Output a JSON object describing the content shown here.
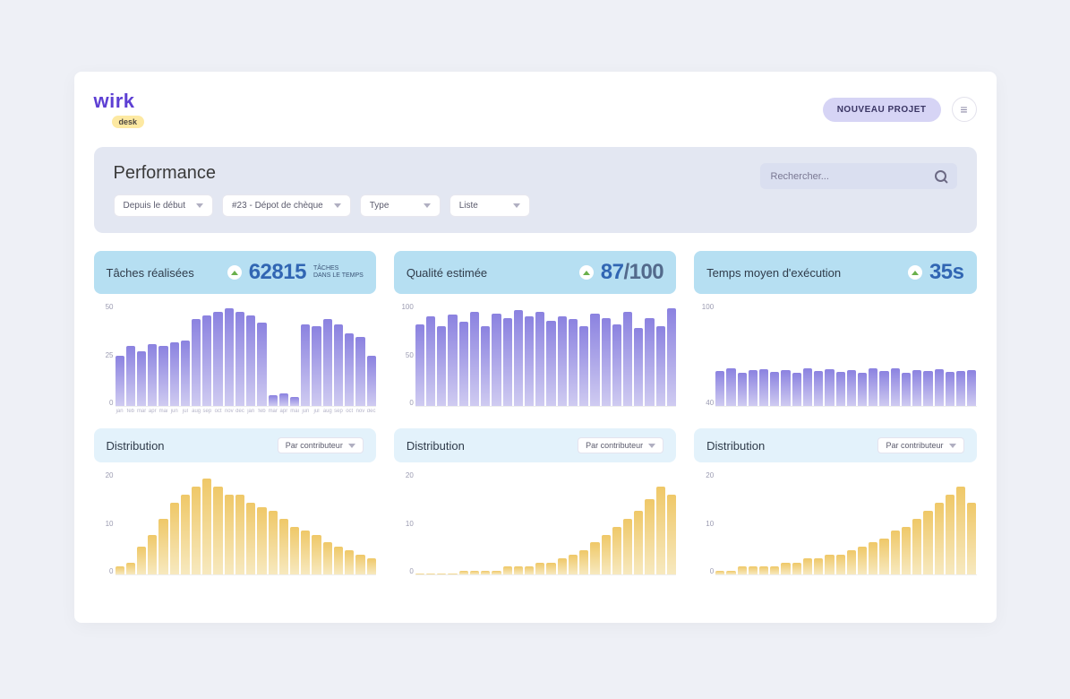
{
  "brand": {
    "name": "wirk",
    "sub": "desk"
  },
  "header": {
    "new_project": "NOUVEAU PROJET"
  },
  "panel": {
    "title": "Performance",
    "filters": {
      "period": "Depuis le début",
      "project": "#23 - Dépot de chèque",
      "type": "Type",
      "view": "Liste"
    },
    "search_placeholder": "Rechercher..."
  },
  "cards": {
    "tasks": {
      "title": "Tâches réalisées",
      "value": "62815",
      "sub1": "TÂCHES",
      "sub2": "DANS LE TEMPS"
    },
    "quality": {
      "title": "Qualité estimée",
      "value": "87",
      "denom": "/100"
    },
    "time": {
      "title": "Temps moyen d'exécution",
      "value": "35s"
    },
    "distribution": {
      "title": "Distribution",
      "pill": "Par contributeur"
    }
  },
  "chart_data": [
    {
      "id": "tasks_bar",
      "type": "bar",
      "title": "Tâches réalisées",
      "ylabel": "",
      "ylim": [
        0,
        55
      ],
      "yticks": [
        0,
        25,
        50
      ],
      "categories": [
        "jan",
        "feb",
        "mar",
        "apr",
        "mai",
        "jun",
        "jul",
        "aug",
        "sep",
        "oct",
        "nov",
        "dec",
        "jan",
        "feb",
        "mar",
        "apr",
        "mai",
        "jun",
        "jul",
        "aug",
        "sep",
        "oct",
        "nov",
        "dec"
      ],
      "values": [
        28,
        33,
        30,
        34,
        33,
        35,
        36,
        48,
        50,
        52,
        54,
        52,
        50,
        46,
        6,
        7,
        5,
        45,
        44,
        48,
        45,
        40,
        38,
        28
      ]
    },
    {
      "id": "quality_bar",
      "type": "bar",
      "title": "Qualité estimée",
      "ylim": [
        0,
        100
      ],
      "yticks": [
        0,
        50,
        100
      ],
      "categories": [
        "",
        "",
        "",
        "",
        "",
        "",
        "",
        "",
        "",
        "",
        "",
        "",
        "",
        "",
        "",
        "",
        "",
        "",
        "",
        "",
        "",
        "",
        "",
        ""
      ],
      "values": [
        82,
        90,
        80,
        92,
        85,
        95,
        80,
        93,
        88,
        96,
        90,
        95,
        86,
        90,
        87,
        80,
        93,
        88,
        82,
        95,
        78,
        88,
        80,
        98
      ]
    },
    {
      "id": "time_bar",
      "type": "bar",
      "title": "Temps moyen d'exécution",
      "ylim": [
        0,
        100
      ],
      "yticks": [
        40,
        100
      ],
      "categories": [
        "",
        "",
        "",
        "",
        "",
        "",
        "",
        "",
        "",
        "",
        "",
        "",
        "",
        "",
        "",
        "",
        "",
        "",
        "",
        "",
        "",
        "",
        "",
        ""
      ],
      "values": [
        35,
        38,
        33,
        36,
        37,
        34,
        36,
        33,
        38,
        35,
        37,
        34,
        36,
        33,
        38,
        35,
        38,
        33,
        36,
        35,
        37,
        34,
        35,
        36
      ]
    },
    {
      "id": "dist_tasks",
      "type": "bar",
      "title": "Distribution",
      "ylim": [
        0,
        25
      ],
      "yticks": [
        0,
        10,
        20
      ],
      "categories": [
        "",
        "",
        "",
        "",
        "",
        "",
        "",
        "",
        "",
        "",
        "",
        "",
        "",
        "",
        "",
        "",
        "",
        "",
        "",
        "",
        "",
        "",
        "",
        ""
      ],
      "values": [
        2,
        3,
        7,
        10,
        14,
        18,
        20,
        22,
        24,
        22,
        20,
        20,
        18,
        17,
        16,
        14,
        12,
        11,
        10,
        8,
        7,
        6,
        5,
        4
      ]
    },
    {
      "id": "dist_quality",
      "type": "bar",
      "title": "Distribution",
      "ylim": [
        0,
        25
      ],
      "yticks": [
        0,
        10,
        20
      ],
      "categories": [
        "",
        "",
        "",
        "",
        "",
        "",
        "",
        "",
        "",
        "",
        "",
        "",
        "",
        "",
        "",
        "",
        "",
        "",
        "",
        "",
        "",
        "",
        "",
        ""
      ],
      "values": [
        0,
        0,
        0,
        0,
        1,
        1,
        1,
        1,
        2,
        2,
        2,
        3,
        3,
        4,
        5,
        6,
        8,
        10,
        12,
        14,
        16,
        19,
        22,
        20
      ]
    },
    {
      "id": "dist_time",
      "type": "bar",
      "title": "Distribution",
      "ylim": [
        0,
        25
      ],
      "yticks": [
        0,
        10,
        20
      ],
      "categories": [
        "",
        "",
        "",
        "",
        "",
        "",
        "",
        "",
        "",
        "",
        "",
        "",
        "",
        "",
        "",
        "",
        "",
        "",
        "",
        "",
        "",
        "",
        "",
        ""
      ],
      "values": [
        1,
        1,
        2,
        2,
        2,
        2,
        3,
        3,
        4,
        4,
        5,
        5,
        6,
        7,
        8,
        9,
        11,
        12,
        14,
        16,
        18,
        20,
        22,
        18
      ]
    }
  ]
}
